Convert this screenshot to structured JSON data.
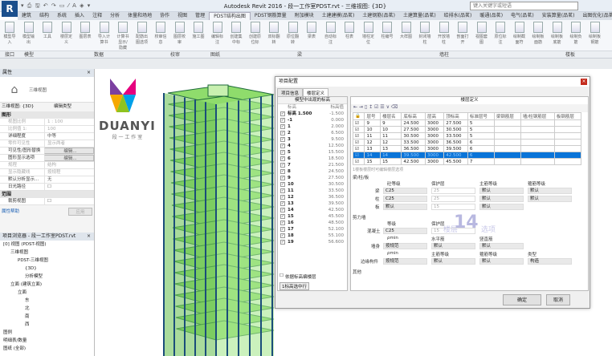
{
  "app": {
    "title": "Autodesk Revit 2016 -   段一工作室PDST.rvt - 三维视图: {3D}",
    "search_placeholder": "键入关键字或短语",
    "qat": "▾ ⎙ 🖫 ↶ ↷ ▭ ⁄ A ◈ ▾"
  },
  "tabs": [
    "建筑",
    "结构",
    "系统",
    "插入",
    "注释",
    "分析",
    "体量和场地",
    "协作",
    "视图",
    "管理",
    "PDST结构出图",
    "PDST钢筋算量",
    "附加模块",
    "土建建模(品茗)",
    "土建钢筋(品茗)",
    "土建算量(品茗)",
    "给排水(品茗)",
    "暖通(品茗)",
    "电气(品茗)",
    "安装算量(品茗)",
    "出图优化(品茗)"
  ],
  "active_tab": "PDST结构出图",
  "ribbon_buttons": [
    "模型导入",
    "模型输出",
    "工具",
    "楼层定义",
    "图层表",
    "导入计算书",
    "计算书显示/隐藏",
    "配筋出图选项",
    "校审信息",
    "图层校审",
    "施工图",
    "编辑标注",
    "创建集中标",
    "创建原位标",
    "双标翻转",
    "原位翻转",
    "梁表",
    "自动标注",
    "柱表",
    "墙柱定位",
    "柱编号",
    "大样图",
    "封闭墙柱",
    "开放墙柱",
    "剖面打开",
    "视图套图",
    "原位标注",
    "绘制截面符",
    "绘制板面筋",
    "绘制板底筋",
    "绘制负筋",
    "绘制板钢筋"
  ],
  "ribbon_groups": [
    "接口",
    "模型",
    "数据",
    "校审",
    "图纸",
    "梁",
    "墙柱",
    "楼板"
  ],
  "properties": {
    "header": "属性",
    "type_name": "三维视图",
    "view_selector": "三维视图: {3D}",
    "edit_type": "编辑类型",
    "section_graphics": "图形",
    "rows": [
      {
        "k": "视图比例",
        "v": "1 : 100",
        "dim": true
      },
      {
        "k": "比例值 1:",
        "v": "100",
        "dim": true
      },
      {
        "k": "详细程度",
        "v": "中等",
        "dim": false
      },
      {
        "k": "零件可见性",
        "v": "显示两者",
        "dim": true
      },
      {
        "k": "可见性/图形替换",
        "v": "编辑...",
        "dim": false,
        "btn": true
      },
      {
        "k": "图形显示选项",
        "v": "编辑...",
        "dim": false,
        "btn": true
      },
      {
        "k": "规程",
        "v": "结构",
        "dim": true
      },
      {
        "k": "显示隐藏线",
        "v": "按规程",
        "dim": true
      },
      {
        "k": "默认分析显示...",
        "v": "无",
        "dim": false
      },
      {
        "k": "日光路径",
        "v": "",
        "dim": false,
        "cb": true
      }
    ],
    "section_extents": "范围",
    "crop_view": "裁剪视图",
    "help_link": "属性帮助",
    "apply": "应用"
  },
  "browser": {
    "header": "项目浏览器 - 段一工作室PDST.rvt",
    "tree": [
      {
        "t": "[0] 视图 (PDST-视图)",
        "d": 0
      },
      {
        "t": "三维视图",
        "d": 1
      },
      {
        "t": "PDST-三维视图",
        "d": 2
      },
      {
        "t": "{3D}",
        "d": 3
      },
      {
        "t": "分析模型",
        "d": 3
      },
      {
        "t": "立面 (建筑立面)",
        "d": 1
      },
      {
        "t": "立面",
        "d": 2
      },
      {
        "t": "东",
        "d": 3
      },
      {
        "t": "北",
        "d": 3
      },
      {
        "t": "南",
        "d": 3
      },
      {
        "t": "西",
        "d": 3
      },
      {
        "t": "图例",
        "d": 0
      },
      {
        "t": "明细表/数量",
        "d": 0
      },
      {
        "t": "图纸 (全部)",
        "d": 0
      }
    ]
  },
  "logo": {
    "name": "DUANYI",
    "sub": "段 一 工 作 室"
  },
  "dialog": {
    "title": "项目配置",
    "tabs": [
      "项目信息",
      "楼层定义"
    ],
    "active_tab": "楼层定义",
    "levels_title": "模型中出现的标高",
    "levels_cols": [
      "标高",
      "标高值"
    ],
    "levels": [
      [
        "标高 1.500",
        "-1.500"
      ],
      [
        "-1",
        "0.000"
      ],
      [
        "1",
        "2.000"
      ],
      [
        "2",
        "6.500"
      ],
      [
        "3",
        "9.500"
      ],
      [
        "4",
        "12.500"
      ],
      [
        "5",
        "15.500"
      ],
      [
        "6",
        "18.500"
      ],
      [
        "7",
        "21.500"
      ],
      [
        "8",
        "24.500"
      ],
      [
        "9",
        "27.500"
      ],
      [
        "10",
        "30.500"
      ],
      [
        "11",
        "33.500"
      ],
      [
        "12",
        "36.500"
      ],
      [
        "13",
        "39.500"
      ],
      [
        "14",
        "42.500"
      ],
      [
        "15",
        "45.500"
      ],
      [
        "16",
        "48.500"
      ],
      [
        "17",
        "52.100"
      ],
      [
        "18",
        "55.100"
      ],
      [
        "19",
        "56.600"
      ]
    ],
    "by_level_checkbox": "依据标高编楼层",
    "select_rows_btn": "1标高选中行",
    "floors_title": "楼层定义",
    "floor_cols": [
      "层号",
      "楼层名",
      "底标高",
      "层高",
      "顶标高",
      "标准层号",
      "梁钢筋层",
      "墙/柱钢筋层",
      "板钢筋层"
    ],
    "floors": [
      [
        "9",
        "9",
        "24.500",
        "3000",
        "27.500",
        "5"
      ],
      [
        "10",
        "10",
        "27.500",
        "3000",
        "30.500",
        "5"
      ],
      [
        "11",
        "11",
        "30.500",
        "3000",
        "33.500",
        "5"
      ],
      [
        "12",
        "12",
        "33.500",
        "3000",
        "36.500",
        "6"
      ],
      [
        "13",
        "13",
        "36.500",
        "3000",
        "39.500",
        "6"
      ],
      [
        "14",
        "14",
        "39.500",
        "3000",
        "42.500",
        "6"
      ],
      [
        "15",
        "15",
        "42.500",
        "3000",
        "45.500",
        "7"
      ]
    ],
    "selected_floor": "14",
    "hint": "1楼板楼层时可编辑楼层选项",
    "beam_section": "梁/柱/板",
    "col_concrete": "砼等级",
    "col_cover": "保护层",
    "col_main": "主筋等级",
    "col_stirrup": "箍筋等级",
    "beam": {
      "label": "梁",
      "c": "C25",
      "cover": "25",
      "main": "默认",
      "stir": "默认"
    },
    "column": {
      "label": "柱",
      "c": "C25",
      "cover": "25",
      "main": "默认",
      "stir": "默认"
    },
    "slab": {
      "label": "板",
      "c": "默认",
      "cover": "15",
      "main": "默认"
    },
    "wall_section": "剪力墙",
    "grade": "等级",
    "cover": "保护层",
    "concrete_label": "混凝土",
    "wall_c": "C25",
    "wall_cover": "15",
    "rho": "ρmin",
    "horiz": "水平筋",
    "vert": "竖直筋",
    "wall_body": "墙身",
    "by_code": "按规范",
    "default": "默认",
    "edge": "边缘构件",
    "main_grade": "主筋等级",
    "stir_grade": "箍筋等级",
    "type": "类型",
    "type_val": "构造",
    "watermark_num": "14",
    "watermark_l": "楼层",
    "watermark_r": "选项",
    "more": "其他",
    "ok": "确定",
    "cancel": "取消"
  }
}
